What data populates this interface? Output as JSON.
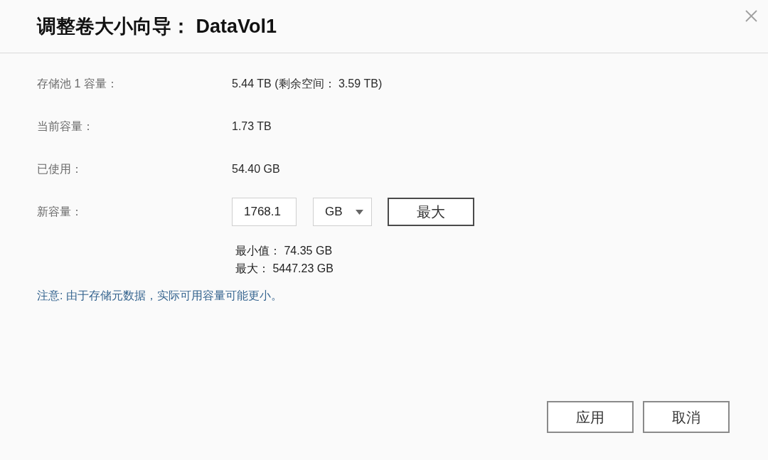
{
  "dialog": {
    "title": "调整卷大小向导： DataVol1"
  },
  "info_rows": [
    {
      "label": "存储池 1 容量：",
      "value": "5.44 TB (剩余空间： 3.59 TB)"
    },
    {
      "label": "当前容量：",
      "value": "1.73 TB"
    },
    {
      "label": "已使用：",
      "value": "54.40 GB"
    }
  ],
  "new_capacity": {
    "label": "新容量：",
    "input": {
      "value": "1768.1"
    },
    "unit": {
      "value": "GB"
    },
    "max_button": "最大"
  },
  "limits": [
    "最小值： 74.35 GB",
    "最大： 5447.23 GB"
  ],
  "note": "注意: 由于存储元数据，实际可用容量可能更小。",
  "buttons": [
    {
      "label": "应用"
    },
    {
      "label": "取消"
    }
  ]
}
